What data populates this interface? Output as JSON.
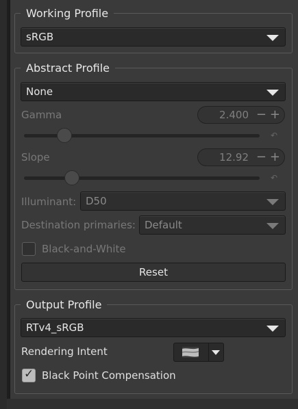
{
  "working_profile": {
    "legend": "Working Profile",
    "selected": "sRGB"
  },
  "abstract_profile": {
    "legend": "Abstract Profile",
    "selected": "None",
    "gamma": {
      "label": "Gamma",
      "value": "2.400",
      "slider_fraction": 0.17
    },
    "slope": {
      "label": "Slope",
      "value": "12.92",
      "slider_fraction": 0.2
    },
    "illuminant": {
      "label": "Illuminant:",
      "selected": "D50"
    },
    "destination_primaries": {
      "label": "Destination primaries:",
      "selected": "Default"
    },
    "black_and_white": {
      "label": "Black-and-White",
      "checked": false
    },
    "reset_label": "Reset"
  },
  "output_profile": {
    "legend": "Output Profile",
    "selected": "RTv4_sRGB",
    "rendering_intent_label": "Rendering Intent",
    "black_point": {
      "label": "Black Point Compensation",
      "checked": true
    }
  },
  "icons": {
    "spin_minus": "−",
    "spin_plus": "+",
    "reset_small": "↶",
    "checkmark": "✓"
  }
}
